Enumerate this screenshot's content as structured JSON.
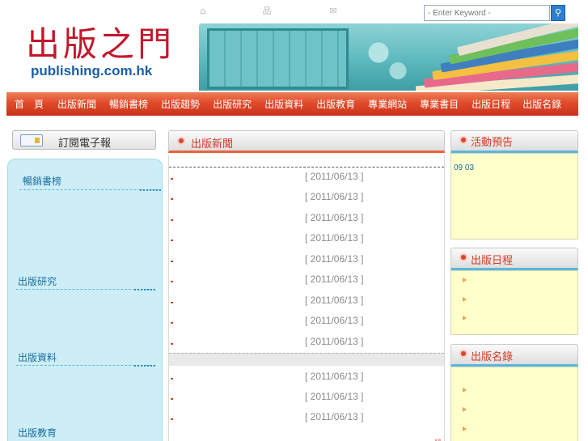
{
  "header": {
    "icons": [
      "home-icon",
      "sitemap-icon",
      "mail-icon"
    ],
    "search_placeholder": "- Enter Keyword -",
    "logo_cn": "出版之門",
    "logo_en": "publishing.com.hk"
  },
  "nav": {
    "items": [
      "首　頁",
      "出版新聞",
      "暢銷書榜",
      "出版趨勢",
      "出版研究",
      "出版資料",
      "出版教育",
      "專業網站",
      "專業書目",
      "出版日程",
      "出版名錄"
    ]
  },
  "left": {
    "subscribe_label": "訂閱電子報",
    "sections": [
      "暢銷書榜",
      "出版研究",
      "出版資料",
      "出版教育"
    ]
  },
  "news": {
    "title": "出版新聞",
    "dates": [
      "[ 2011/06/13 ]",
      "[ 2011/06/13 ]",
      "[ 2011/06/13 ]",
      "[ 2011/06/13 ]",
      "[ 2011/06/13 ]",
      "[ 2011/06/13 ]",
      "[ 2011/06/13 ]",
      "[ 2011/06/13 ]",
      "[ 2011/06/13 ]",
      "[ 2011/06/13 ]",
      "[ 2011/06/13 ]",
      "[ 2011/06/13 ]"
    ]
  },
  "right": {
    "events_title": "活動預告",
    "events_text": "09 03",
    "schedule_title": "出版日程",
    "directory_title": "出版名錄"
  },
  "colors": {
    "nav_red": "#e14b2b",
    "logo_red": "#c2182b",
    "logo_blue": "#1c5fa5",
    "panel_cyan": "#cdeef7",
    "panel_yellow": "#ffffcc",
    "accent_blue": "#2f7fd0"
  }
}
